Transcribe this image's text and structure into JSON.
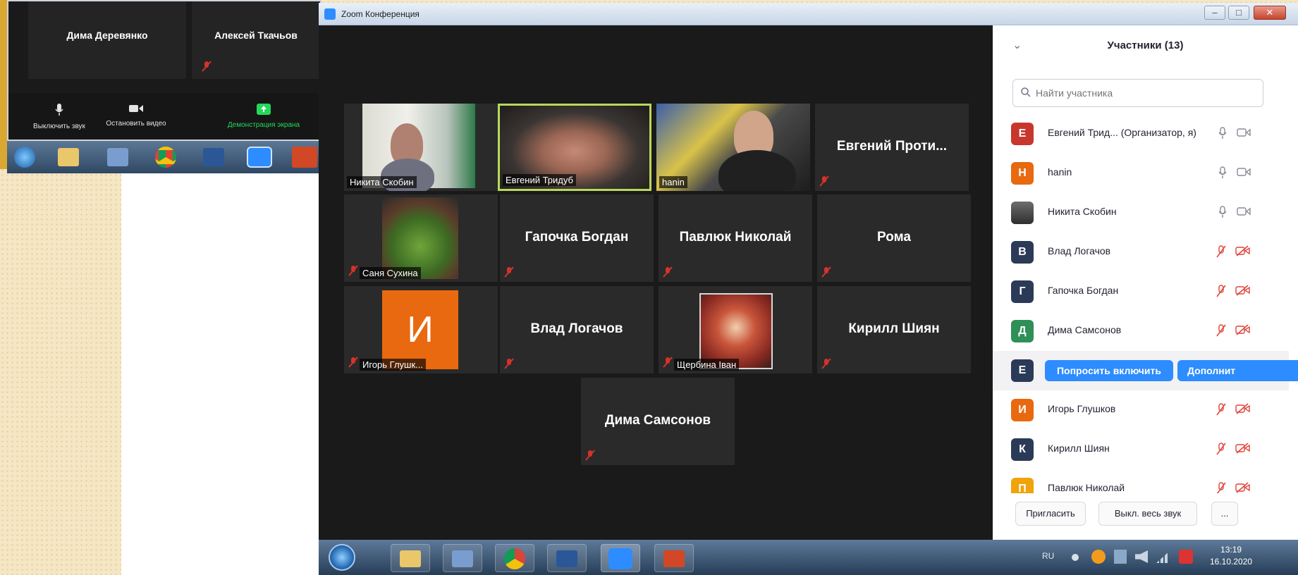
{
  "app": {
    "window_title": "Zoom Конференция"
  },
  "back_window": {
    "tiles": [
      {
        "name": "Дима Деревянко"
      },
      {
        "name": "Алексей Ткачьов"
      }
    ],
    "controls": [
      {
        "label": "Выключить звук",
        "icon": "microphone-icon"
      },
      {
        "label": "Остановить видео",
        "icon": "camera-icon"
      },
      {
        "label": "Демонстрация экрана",
        "icon": "share-screen-icon"
      }
    ]
  },
  "gallery": {
    "tiles": [
      {
        "name": "Никита Скобин",
        "type": "video"
      },
      {
        "name": "Евгений Тридуб",
        "type": "video",
        "active": true
      },
      {
        "name": "hanin",
        "type": "video"
      },
      {
        "name": "Евгений Проти...",
        "type": "name",
        "muted": true
      },
      {
        "name": "Саня Сухина",
        "type": "image",
        "muted": true
      },
      {
        "name": "Гапочка Богдан",
        "type": "name",
        "muted": true
      },
      {
        "name": "Павлюк Николай",
        "type": "name",
        "muted": true
      },
      {
        "name": "Рома",
        "type": "name",
        "muted": true
      },
      {
        "name": "Игорь Глушк...",
        "type": "initial",
        "initial": "И",
        "muted": true
      },
      {
        "name": "Влад Логачов",
        "type": "name",
        "muted": true
      },
      {
        "name": "Щербина Іван",
        "type": "image",
        "muted": true
      },
      {
        "name": "Кирилл Шиян",
        "type": "name",
        "muted": true
      },
      {
        "name": "Дима Самсонов",
        "type": "name",
        "muted": true
      }
    ]
  },
  "participants": {
    "title": "Участники (13)",
    "search_placeholder": "Найти участника",
    "items": [
      {
        "initial": "Е",
        "color": "#c8372d",
        "name": "Евгений Трид... (Организатор, я)",
        "mic": "on",
        "video": "on"
      },
      {
        "initial": "H",
        "color": "#e8690f",
        "name": "hanin",
        "mic": "on",
        "video": "on"
      },
      {
        "initial": "",
        "color": "#4a4a4a",
        "name": "Никита Скобин",
        "mic": "on",
        "video": "on"
      },
      {
        "initial": "В",
        "color": "#2b3a57",
        "name": "Влад Логачов",
        "mic": "off",
        "video": "off"
      },
      {
        "initial": "Г",
        "color": "#2b3a57",
        "name": "Гапочка Богдан",
        "mic": "off",
        "video": "off"
      },
      {
        "initial": "Д",
        "color": "#2e8f57",
        "name": "Дима Самсонов",
        "mic": "off",
        "video": "off"
      },
      {
        "initial": "Е",
        "color": "#2b3a57",
        "name": "",
        "hovered": true
      },
      {
        "initial": "И",
        "color": "#e8690f",
        "name": "Игорь Глушков",
        "mic": "off",
        "video": "off"
      },
      {
        "initial": "К",
        "color": "#2b3a57",
        "name": "Кирилл Шиян",
        "mic": "off",
        "video": "off"
      },
      {
        "initial": "П",
        "color": "#f0a30a",
        "name": "Павлюк Николай",
        "mic": "off",
        "video": "off"
      }
    ],
    "hover_actions": {
      "ask_unmute": "Попросить включить",
      "more": "Дополнит"
    },
    "footer": {
      "invite": "Пригласить",
      "mute_all": "Выкл. весь звук",
      "more": "..."
    }
  },
  "taskbar": {
    "icons": [
      "start-orb-icon",
      "explorer-icon",
      "paint-icon",
      "chrome-icon",
      "word-icon",
      "zoom-icon",
      "powerpoint-icon"
    ],
    "lang": "RU",
    "time": "13:19",
    "date": "16.10.2020"
  },
  "colors": {
    "zoom_blue": "#2d8cff",
    "muted_red": "#d6322b",
    "active_border": "#b9d85c"
  }
}
